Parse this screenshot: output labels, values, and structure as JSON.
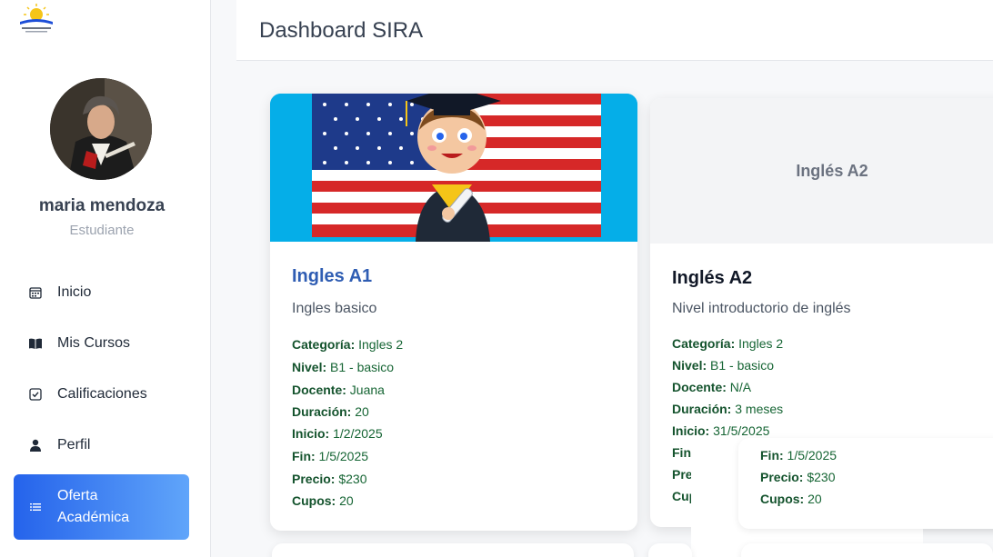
{
  "header": {
    "title": "Dashboard SIRA"
  },
  "user": {
    "name": "maria mendoza",
    "role": "Estudiante"
  },
  "nav": {
    "items": [
      {
        "label": "Inicio",
        "icon": "calendar-icon"
      },
      {
        "label": "Mis Cursos",
        "icon": "book-icon"
      },
      {
        "label": "Calificaciones",
        "icon": "checkbox-icon"
      },
      {
        "label": "Perfil",
        "icon": "user-icon"
      },
      {
        "label": "Oferta Académica",
        "icon": "list-icon",
        "active": true
      }
    ]
  },
  "colors": {
    "accent": "#2563eb",
    "accent_light": "#60a5fa",
    "title_blue": "#2f5db3",
    "detail_green": "#166534"
  },
  "courses": [
    {
      "title": "Ingles A1",
      "description": "Ingles basico",
      "labels": {
        "categoria": "Categoría:",
        "nivel": "Nivel:",
        "docente": "Docente:",
        "duracion": "Duración:",
        "inicio": "Inicio:",
        "fin": "Fin:",
        "precio": "Precio:",
        "cupos": "Cupos:"
      },
      "categoria": "Ingles 2",
      "nivel": "B1 - basico",
      "docente": "Juana",
      "duracion": "20",
      "inicio": "1/2/2025",
      "fin": "1/5/2025",
      "precio": "$230",
      "cupos": "20"
    },
    {
      "title": "Inglés A2",
      "image_placeholder": "Inglés A2",
      "description": "Nivel introductorio de inglés",
      "labels": {
        "categoria": "Categoría:",
        "nivel": "Nivel:",
        "docente": "Docente:",
        "duracion": "Duración:",
        "inicio": "Inicio:",
        "fin": "Fin",
        "precio": "Pre",
        "cupos": "Cup"
      },
      "categoria": "Ingles 2",
      "nivel": "B1 - basico",
      "docente": "N/A",
      "duracion": "3 meses",
      "inicio": "31/5/2025"
    },
    {
      "labels": {
        "fin": "Fin:",
        "precio": "Precio:",
        "cupos": "Cupos:"
      },
      "fin": "1/5/2025",
      "precio": "$230",
      "cupos": "20"
    }
  ]
}
